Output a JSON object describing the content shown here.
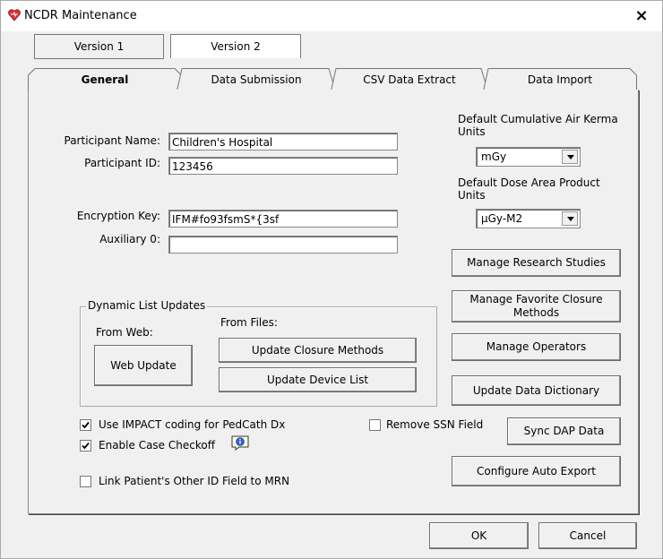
{
  "window": {
    "title": "NCDR Maintenance",
    "close": "×"
  },
  "version_tabs": [
    "Version 1",
    "Version 2"
  ],
  "tabs": [
    "General",
    "Data Submission",
    "CSV Data Extract",
    "Data Import"
  ],
  "fields": {
    "participant_name_label": "Participant Name:",
    "participant_name_value": "Children's Hospital",
    "participant_id_label": "Participant ID:",
    "participant_id_value": "123456",
    "encryption_key_label": "Encryption Key:",
    "encryption_key_value": "IFM#fo93fsmS*{3sf",
    "auxiliary_label": "Auxiliary 0:",
    "auxiliary_value": ""
  },
  "units": {
    "air_kerma_label": "Default Cumulative Air Kerma Units",
    "air_kerma_value": "mGy",
    "dose_area_label": "Default Dose Area Product Units",
    "dose_area_value": "µGy-M2"
  },
  "dynamic": {
    "group_label": "Dynamic List Updates",
    "from_web": "From Web:",
    "from_files": "From Files:",
    "web_update": "Web Update",
    "update_closure": "Update Closure Methods",
    "update_device": "Update Device List"
  },
  "right_buttons": {
    "research": "Manage Research Studies",
    "closure": "Manage Favorite Closure Methods",
    "operators": "Manage Operators",
    "dictionary": "Update Data Dictionary",
    "sync": "Sync DAP Data",
    "auto_export": "Configure Auto Export"
  },
  "checkboxes": {
    "impact": {
      "label": "Use IMPACT coding for PedCath Dx",
      "checked": true
    },
    "checkoff": {
      "label": "Enable Case Checkoff",
      "checked": true
    },
    "link": {
      "label": "Link Patient's Other ID Field to MRN",
      "checked": false
    },
    "ssn": {
      "label": "Remove SSN Field",
      "checked": false
    }
  },
  "footer": {
    "ok": "OK",
    "cancel": "Cancel"
  }
}
